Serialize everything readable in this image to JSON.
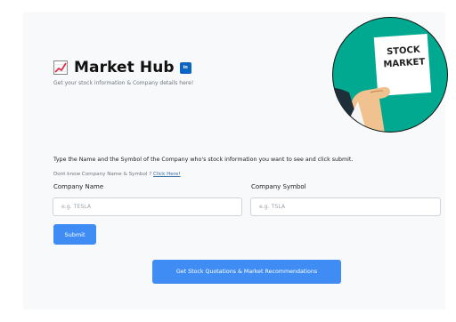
{
  "header": {
    "title": "Market Hub",
    "subtitle": "Get your stock information & Company details here!",
    "linkedin_label": "in"
  },
  "hero": {
    "sign_line1": "STOCK",
    "sign_line2": "MARKET"
  },
  "form": {
    "instruction": "Type the Name and the Symbol of the Company who's stock information you want to see and click submit.",
    "hint_text": "Dont know Company Name & Symbol ?",
    "hint_link": "Click Here!",
    "company_name_label": "Company Name",
    "company_name_placeholder": "e.g. TESLA",
    "company_name_value": "",
    "company_symbol_label": "Company Symbol",
    "company_symbol_placeholder": "e.g. TSLA",
    "company_symbol_value": "",
    "submit_label": "Submit"
  },
  "actions": {
    "quotes_label": "Get Stock Quotations & Market Recommendations"
  },
  "colors": {
    "primary": "#3f8cf4",
    "linkedin": "#0a66c2",
    "hero_bg": "#00a98f"
  },
  "icons": {
    "chart": "chart-increasing-icon",
    "linkedin": "linkedin-icon"
  }
}
